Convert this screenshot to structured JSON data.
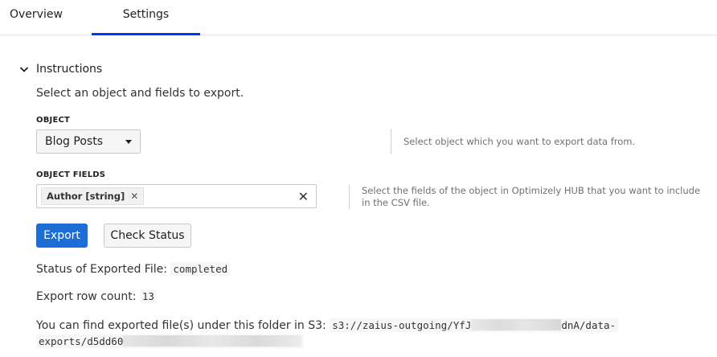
{
  "tabs": [
    {
      "label": "Overview"
    },
    {
      "label": "Settings"
    }
  ],
  "active_tab": "Settings",
  "accent_color": "#0037ff",
  "button_color": "#1c6ed6",
  "section": {
    "title": "Instructions",
    "description": "Select an object and fields to export."
  },
  "object": {
    "label": "OBJECT",
    "selected": "Blog Posts",
    "help": "Select object which you want to export data from."
  },
  "object_fields": {
    "label": "OBJECT FIELDS",
    "chips": [
      "Author [string]"
    ],
    "help": "Select the fields of the object in Optimizely HUB that you want to include in the CSV file."
  },
  "buttons": {
    "export": "Export",
    "check_status": "Check Status"
  },
  "status": {
    "label": "Status of Exported File:",
    "value": "completed"
  },
  "row_count": {
    "label": "Export row count:",
    "value": "13"
  },
  "s3": {
    "label": "You can find exported file(s) under this folder in S3:",
    "path_start": "s3://zaius-outgoing/YfJ",
    "path_mid": "dnA/data-",
    "path_line2": "exports/d5dd60"
  }
}
